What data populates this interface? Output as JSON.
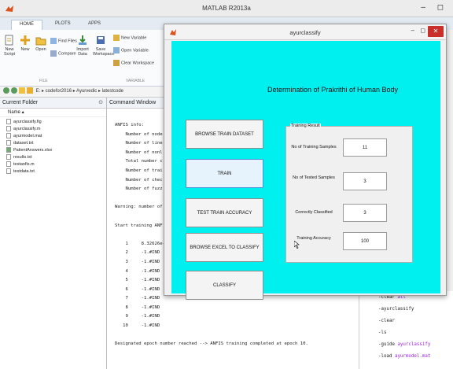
{
  "matlab": {
    "title": "MATLAB R2013a",
    "tabs": [
      "HOME",
      "PLOTS",
      "APPS"
    ],
    "ribbon": {
      "new_script": "New Script",
      "new": "New",
      "open": "Open",
      "find_files": "Find Files",
      "compare": "Compare",
      "import_data": "Import Data",
      "save_workspace": "Save Workspace",
      "new_variable": "New Variable",
      "open_variable": "Open Variable",
      "clear_workspace": "Clear Workspace",
      "group_file": "FILE",
      "group_variable": "VARIABLE"
    },
    "path": "E: ▸ codefor2016 ▸ Ayurvedic ▸ latestcode",
    "current_folder": {
      "title": "Current Folder",
      "column": "Name ▴",
      "files": [
        "ayurclassify.fig",
        "ayurclassify.m",
        "ayurmodel.mat",
        "dataset.txt",
        "PatientAnswers.xlsx",
        "results.txt",
        "testanfis.m",
        "testdata.txt"
      ]
    },
    "command_window": {
      "title": "Command Window",
      "lines": [
        "ANFIS info:",
        "    Number of node",
        "    Number of line",
        "    Number of nonl",
        "    Total number c",
        "    Number of trai",
        "    Number of chec",
        "    Number of fuzz",
        "",
        "Warning: number of",
        "",
        "Start training ANF",
        "",
        "    1     8.32626e-",
        "    2     -1.#IND",
        "    3     -1.#IND",
        "    4     -1.#IND",
        "    5     -1.#IND",
        "    6     -1.#IND",
        "    7     -1.#IND",
        "    8     -1.#IND",
        "    9     -1.#IND",
        "   10     -1.#IND",
        "",
        "Designated epoch number reached --> ANFIS training completed at epoch 10."
      ]
    },
    "history": [
      {
        "text": "clear ",
        "arg": "all"
      },
      {
        "text": "ayurclassify",
        "arg": ""
      },
      {
        "text": "clear",
        "arg": ""
      },
      {
        "text": "ls",
        "arg": ""
      },
      {
        "text": "guide ",
        "arg": "ayurclassify"
      },
      {
        "text": "load ",
        "arg": "ayurmodel.mat"
      }
    ]
  },
  "figure": {
    "title": "ayurclassify",
    "heading": "Determination of Prakrithi of Human Body",
    "buttons": {
      "browse_train": "BROWSE TRAIN DATASET",
      "train": "TRAIN",
      "test_train_accuracy": "TEST TRAIN ACCURACY",
      "browse_excel": "BROWSE EXCEL TO CLASSIFY",
      "classify": "CLASSIFY"
    },
    "training_result": {
      "title": "Training Result",
      "training_samples_label": "No of Training Samples",
      "training_samples": "11",
      "tested_samples_label": "No of Tested Samples",
      "tested_samples": "3",
      "correctly_classified_label": "Correctly Classified",
      "correctly_classified": "3",
      "training_accuracy_label": "Training Accuracy",
      "training_accuracy": "100"
    },
    "colors": {
      "canvas": "#00f0f0",
      "close": "#c9302c"
    }
  }
}
